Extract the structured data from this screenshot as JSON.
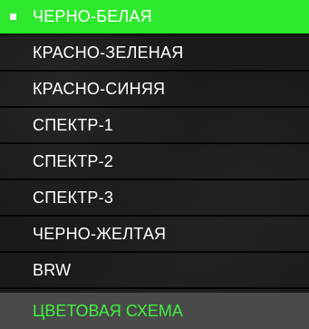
{
  "menu": {
    "items": [
      {
        "label": "ЧЕРНО-БЕЛАЯ",
        "selected": true
      },
      {
        "label": "КРАСНО-ЗЕЛЕНАЯ",
        "selected": false
      },
      {
        "label": "КРАСНО-СИНЯЯ",
        "selected": false
      },
      {
        "label": "СПЕКТР-1",
        "selected": false
      },
      {
        "label": "СПЕКТР-2",
        "selected": false
      },
      {
        "label": "СПЕКТР-3",
        "selected": false
      },
      {
        "label": "ЧЕРНО-ЖЕЛТАЯ",
        "selected": false
      },
      {
        "label": "BRW",
        "selected": false
      }
    ],
    "title": "ЦВЕТОВАЯ СХЕМА"
  },
  "colors": {
    "selected_background": "#2de82d",
    "title_text": "#3ff03f",
    "title_background": "#4a4a4a",
    "item_text": "#ffffff"
  }
}
